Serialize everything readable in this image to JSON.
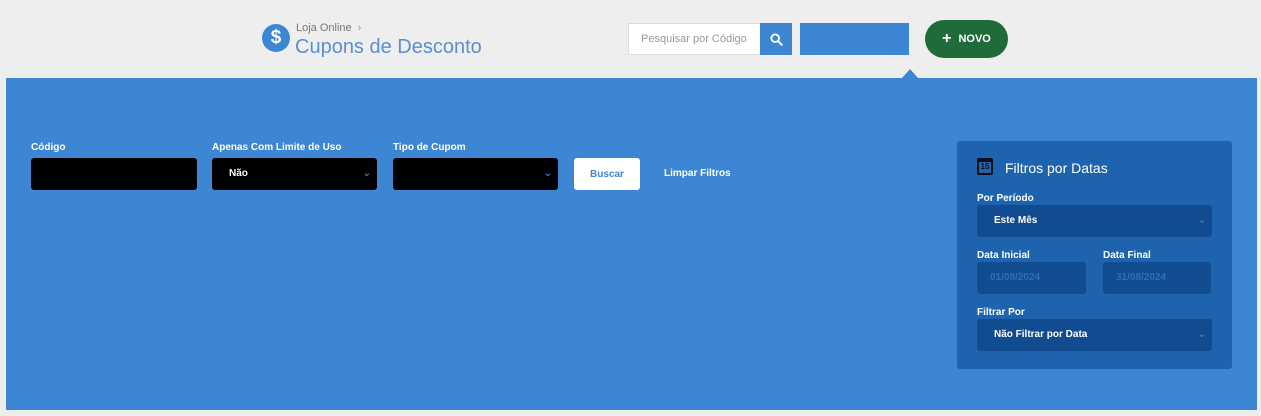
{
  "header": {
    "breadcrumb": "Loja Online",
    "breadcrumb_sep": "›",
    "title": "Cupons de Desconto",
    "brand_icon": "$",
    "search_placeholder": "Pesquisar por Código",
    "new_button": "NOVO",
    "new_icon": "+"
  },
  "filters": {
    "codigo_label": "Código",
    "limite_label": "Apenas Com Limite de Uso",
    "limite_value": "Não",
    "tipo_label": "Tipo de Cupom",
    "tipo_value": "",
    "buscar": "Buscar",
    "limpar": "Limpar Filtros"
  },
  "date_filters": {
    "title": "Filtros por Datas",
    "calendar_day": "15",
    "periodo_label": "Por Período",
    "periodo_value": "Este Mês",
    "data_inicial_label": "Data Inicial",
    "data_inicial_value": "01/08/2024",
    "data_final_label": "Data Final",
    "data_final_value": "31/08/2024",
    "filtrar_por_label": "Filtrar Por",
    "filtrar_por_value": "Não Filtrar por Data"
  },
  "colors": {
    "accent": "#3d86d3",
    "new_button": "#1f6b3a",
    "date_card": "#1e63ad"
  }
}
